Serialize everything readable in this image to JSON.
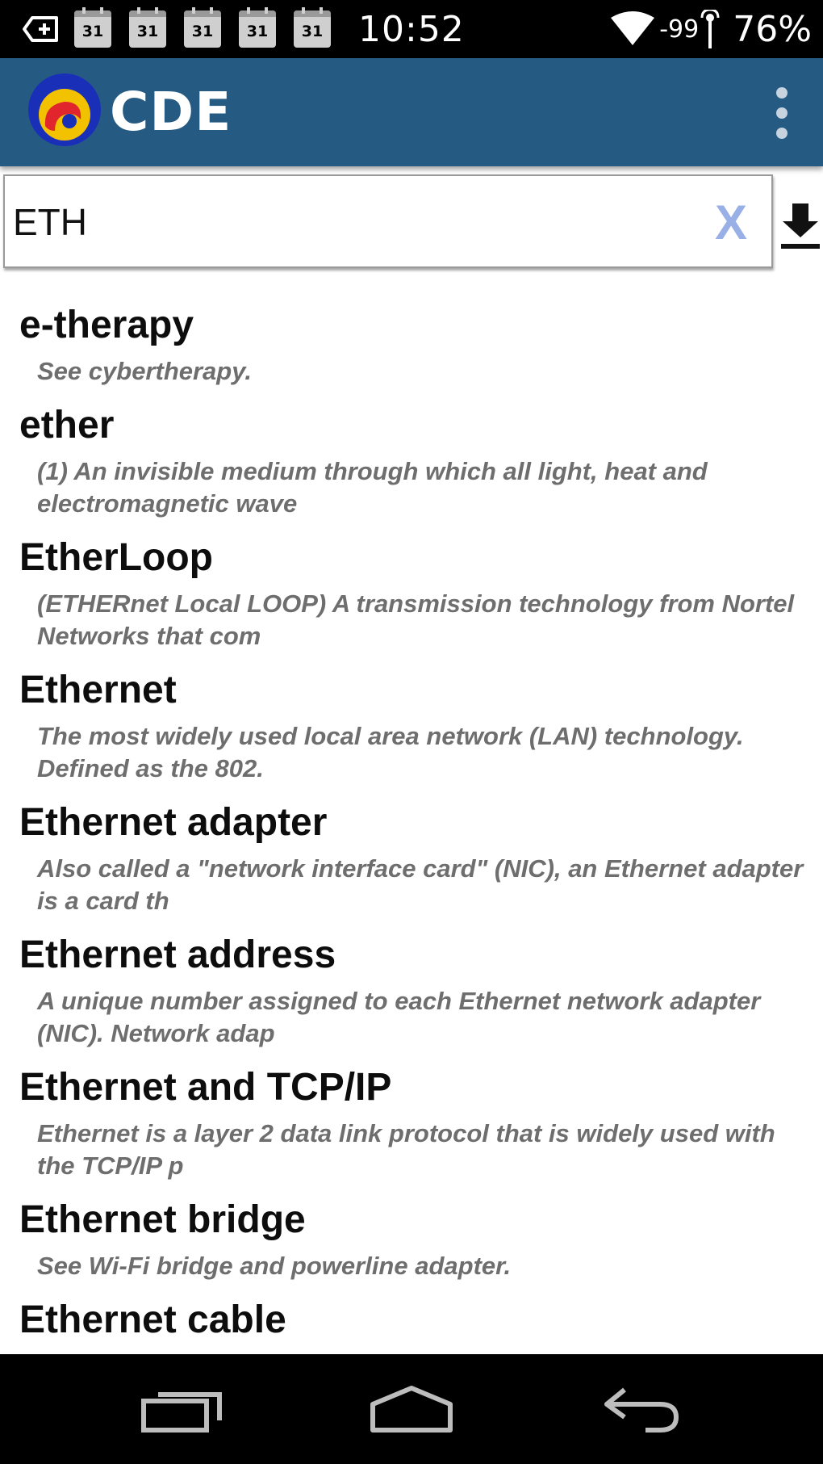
{
  "status_bar": {
    "time": "10:52",
    "notifications": [
      "31",
      "31",
      "31",
      "31",
      "31"
    ],
    "signal_text": "-99",
    "battery": "76%",
    "icons": [
      "add-notification-icon",
      "calendar-icon",
      "wifi-icon",
      "signal-antenna-icon"
    ]
  },
  "app_bar": {
    "title": "CDE",
    "logo_icon": "cde-logo-icon",
    "menu_icon": "overflow-menu-icon",
    "bar_color": "#255a83"
  },
  "search": {
    "value": "ETH",
    "clear_label": "X",
    "download_icon": "download-icon"
  },
  "results": [
    {
      "term": "e-therapy",
      "definition": "See cybertherapy."
    },
    {
      "term": "ether",
      "definition": "(1) An invisible medium through which all light, heat and electromagnetic wave"
    },
    {
      "term": "EtherLoop",
      "definition": "(ETHERnet Local LOOP)  A transmission technology from Nortel Networks that com"
    },
    {
      "term": "Ethernet",
      "definition": "The most widely used local area network (LAN) technology. Defined as the 802."
    },
    {
      "term": "Ethernet adapter",
      "definition": "Also called a \"network interface card\" (NIC), an Ethernet adapter is a card th"
    },
    {
      "term": "Ethernet address",
      "definition": "A unique number assigned to each Ethernet network adapter (NIC).  Network adap"
    },
    {
      "term": "Ethernet and TCP/IP",
      "definition": "Ethernet is a layer 2 data link protocol that is widely used with the TCP/IP p"
    },
    {
      "term": "Ethernet bridge",
      "definition": "See Wi-Fi bridge and powerline adapter."
    },
    {
      "term": "Ethernet cable",
      "definition": ""
    }
  ],
  "nav_bar": {
    "icons": [
      "recent-apps-icon",
      "home-icon",
      "back-icon"
    ]
  }
}
